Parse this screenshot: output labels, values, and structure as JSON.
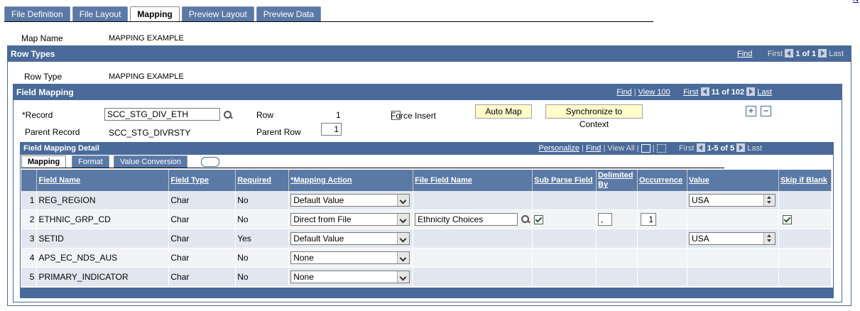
{
  "tabs": [
    "File Definition",
    "File Layout",
    "Mapping",
    "Preview Layout",
    "Preview Data"
  ],
  "active_tab": "Mapping",
  "top_link": "N",
  "map_name_label": "Map Name",
  "map_name_value": "MAPPING EXAMPLE",
  "row_types": {
    "title": "Row Types",
    "find": "Find",
    "first": "First",
    "count": "1 of 1",
    "last": "Last",
    "row_type_label": "Row Type",
    "row_type_value": "MAPPING EXAMPLE"
  },
  "field_mapping": {
    "title": "Field Mapping",
    "find": "Find",
    "view100": "View 100",
    "first": "First",
    "count": "11 of 102",
    "last": "Last",
    "record_label": "*Record",
    "record_value": "SCC_STG_DIV_ETH",
    "row_label": "Row",
    "row_value": "1",
    "force_insert_label": "Force Insert",
    "auto_map_label": "Auto Map",
    "sync_label": "Synchronize to Context",
    "parent_record_label": "Parent Record",
    "parent_record_value": "SCC_STG_DIVRSTY",
    "parent_row_label": "Parent Row",
    "parent_row_value": "1"
  },
  "detail": {
    "title": "Field Mapping Detail",
    "personalize": "Personalize",
    "find": "Find",
    "view_all": "View All",
    "first": "First",
    "count": "1-5 of 5",
    "last": "Last",
    "subtabs": [
      "Mapping",
      "Format",
      "Value Conversion"
    ],
    "columns": [
      "Field Name",
      "Field Type",
      "Required",
      "*Mapping Action",
      "File Field Name",
      "Sub Parse Field",
      "Delimited By",
      "Occurrence",
      "Value",
      "Skip if Blank"
    ],
    "rows": [
      {
        "num": "1",
        "field": "REG_REGION",
        "type": "Char",
        "required": "No",
        "action": "Default Value",
        "file_field": "",
        "sub_parse": null,
        "delim": "",
        "occ": "",
        "value": "USA",
        "skip": null
      },
      {
        "num": "2",
        "field": "ETHNIC_GRP_CD",
        "type": "Char",
        "required": "No",
        "action": "Direct from File",
        "file_field": "Ethnicity Choices",
        "sub_parse": true,
        "delim": ",",
        "occ": "1",
        "value": "",
        "skip": true
      },
      {
        "num": "3",
        "field": "SETID",
        "type": "Char",
        "required": "Yes",
        "action": "Default Value",
        "file_field": "",
        "sub_parse": null,
        "delim": "",
        "occ": "",
        "value": "USA",
        "skip": null
      },
      {
        "num": "4",
        "field": "APS_EC_NDS_AUS",
        "type": "Char",
        "required": "No",
        "action": "None",
        "file_field": "",
        "sub_parse": null,
        "delim": "",
        "occ": "",
        "value": "",
        "skip": null
      },
      {
        "num": "5",
        "field": "PRIMARY_INDICATOR",
        "type": "Char",
        "required": "No",
        "action": "None",
        "file_field": "",
        "sub_parse": null,
        "delim": "",
        "occ": "",
        "value": "",
        "skip": null
      }
    ]
  }
}
